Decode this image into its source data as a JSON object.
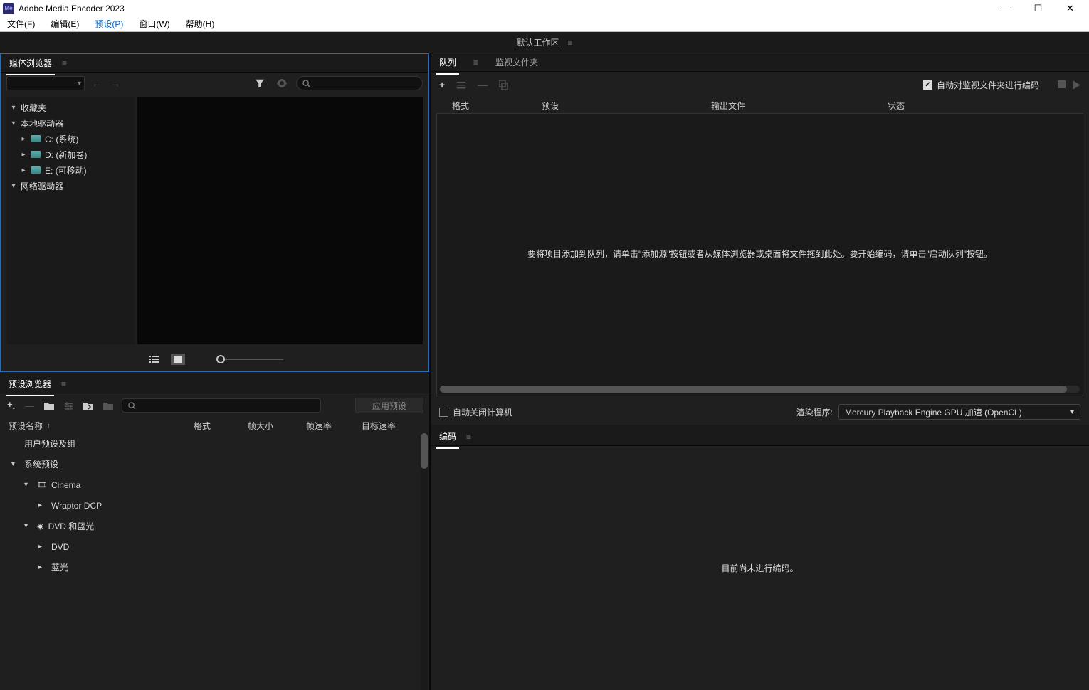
{
  "titlebar": {
    "title": "Adobe Media Encoder 2023",
    "icon_text": "Me"
  },
  "menubar": {
    "file": "文件(F)",
    "edit": "编辑(E)",
    "preset": "预设(P)",
    "window": "窗口(W)",
    "help": "帮助(H)"
  },
  "workspace": {
    "default": "默认工作区"
  },
  "media_browser": {
    "title": "媒体浏览器",
    "tree": {
      "favorites": "收藏夹",
      "local_drives": "本地驱动器",
      "drive_c": "C: (系统)",
      "drive_d": "D: (新加卷)",
      "drive_e": "E: (可移动)",
      "network_drives": "网络驱动器"
    }
  },
  "preset_browser": {
    "title": "预设浏览器",
    "apply": "应用预设",
    "headers": {
      "name": "预设名称",
      "format": "格式",
      "frame_size": "帧大小",
      "frame_rate": "帧速率",
      "target_rate": "目标速率"
    },
    "rows": {
      "user": "用户预设及组",
      "system": "系统预设",
      "cinema": "Cinema",
      "wraptor": "Wraptor DCP",
      "dvd_blu": "DVD 和蓝光",
      "dvd": "DVD",
      "bluray": "蓝光"
    }
  },
  "queue": {
    "tab_queue": "队列",
    "tab_watch": "监视文件夹",
    "auto_encode": "自动对监视文件夹进行编码",
    "headers": {
      "format": "格式",
      "preset": "预设",
      "output": "输出文件",
      "status": "状态"
    },
    "empty_msg": "要将项目添加到队列，请单击\"添加源\"按钮或者从媒体浏览器或桌面将文件拖到此处。要开始编码，请单击\"启动队列\"按钮。",
    "auto_off": "自动关闭计算机",
    "render_label": "渲染程序:",
    "render_value": "Mercury Playback Engine GPU 加速 (OpenCL)"
  },
  "encoding": {
    "title": "编码",
    "idle": "目前尚未进行编码。"
  }
}
